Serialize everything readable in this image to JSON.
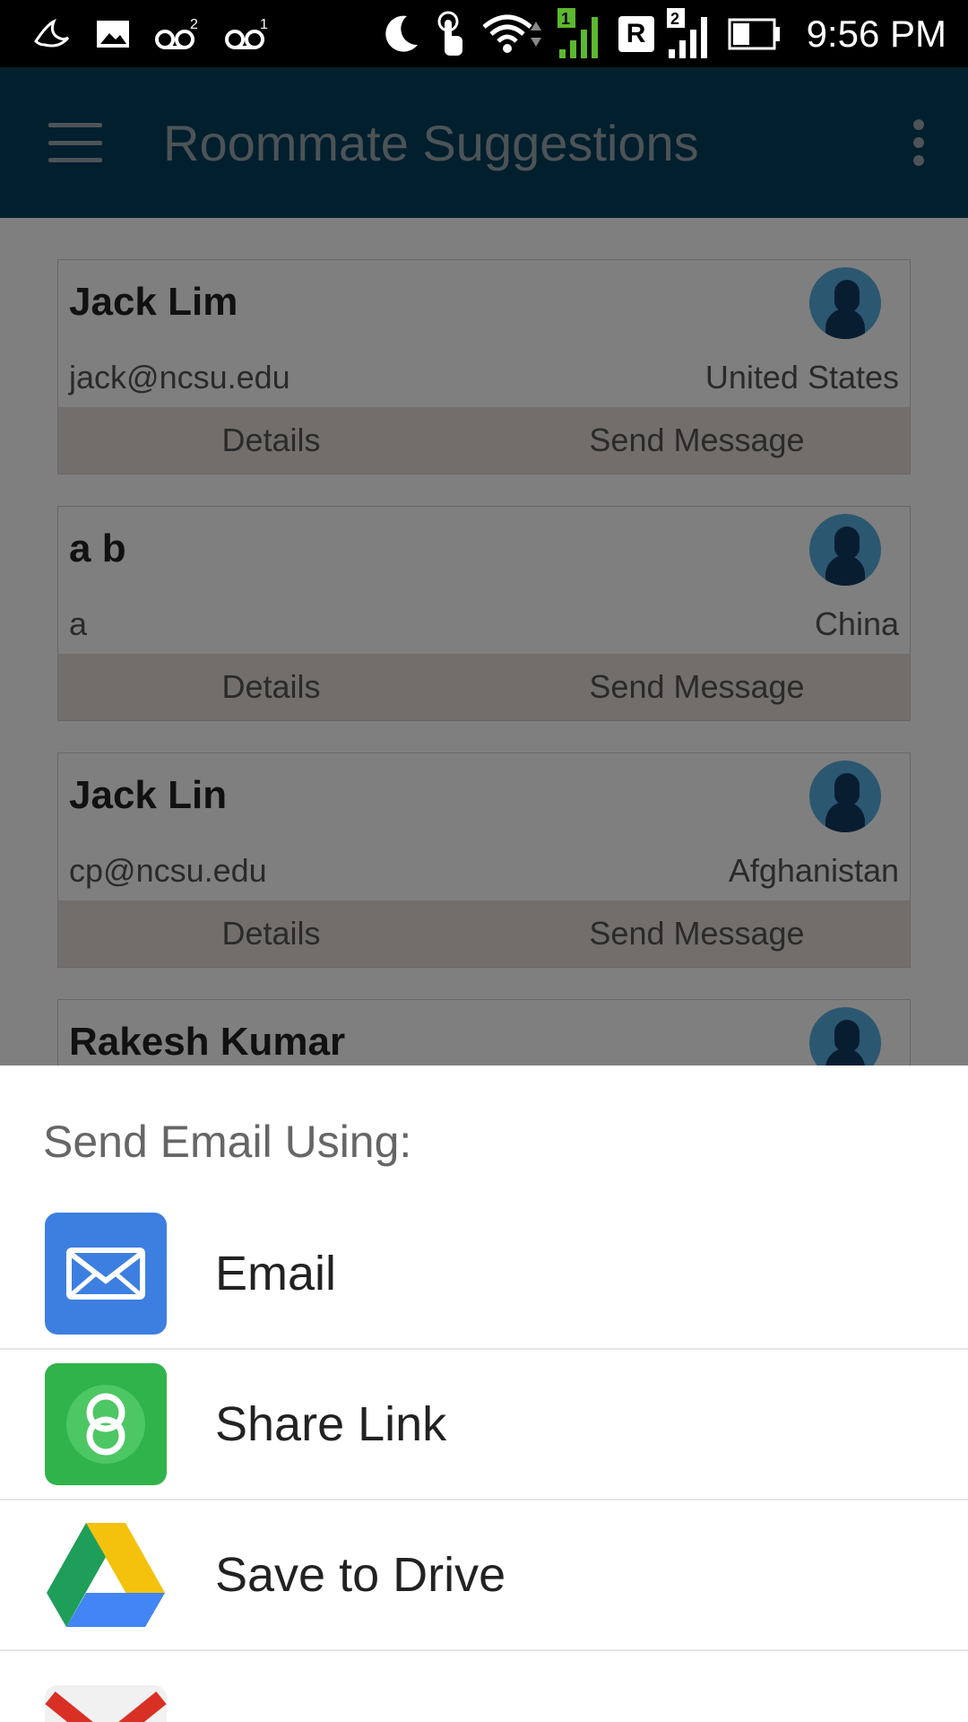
{
  "status_bar": {
    "time": "9:56 PM",
    "badge_r": "R",
    "sim_1": "1",
    "sim_2": "2"
  },
  "app_bar": {
    "title": "Roommate Suggestions"
  },
  "cards": [
    {
      "name": "Jack Lim",
      "email": "jack@ncsu.edu",
      "country": "United States",
      "details_label": "Details",
      "message_label": "Send Message"
    },
    {
      "name": "a b",
      "email": "a",
      "country": "China",
      "details_label": "Details",
      "message_label": "Send Message"
    },
    {
      "name": "Jack Lin",
      "email": "cp@ncsu.edu",
      "country": "Afghanistan",
      "details_label": "Details",
      "message_label": "Send Message"
    },
    {
      "name": "Rakesh Kumar",
      "email": "",
      "country": "",
      "details_label": "",
      "message_label": ""
    }
  ],
  "share_sheet": {
    "title": "Send Email Using:",
    "items": [
      {
        "label": "Email",
        "icon": "email-app-icon"
      },
      {
        "label": "Share Link",
        "icon": "share-link-icon"
      },
      {
        "label": "Save to Drive",
        "icon": "google-drive-icon"
      },
      {
        "label": "",
        "icon": "gmail-icon"
      }
    ]
  },
  "colors": {
    "app_bar": "#053f5c",
    "card_actions": "#e4dcd6",
    "avatar": "#58aee0",
    "email_icon": "#3d7fe0",
    "share_link_icon": "#2fb34a"
  }
}
